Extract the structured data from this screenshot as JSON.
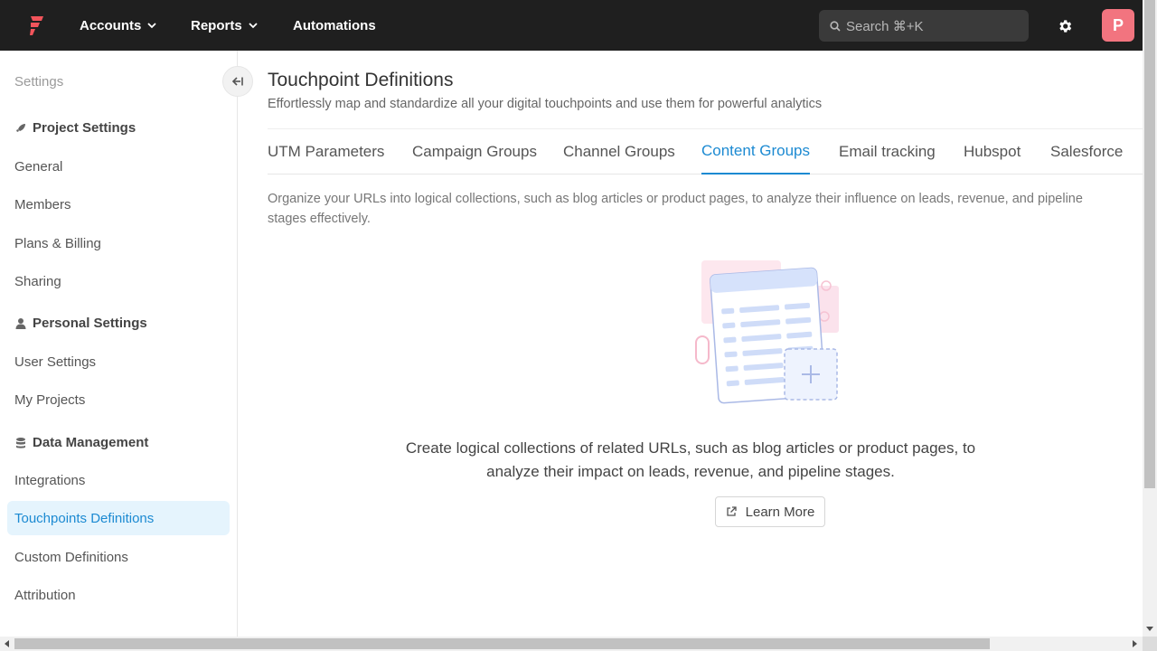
{
  "topbar": {
    "nav": [
      {
        "label": "Accounts",
        "has_dropdown": true
      },
      {
        "label": "Reports",
        "has_dropdown": true
      },
      {
        "label": "Automations",
        "has_dropdown": false
      }
    ],
    "search_placeholder": "Search ⌘+K",
    "avatar_initial": "P",
    "colors": {
      "bar": "#1f1f1f",
      "logo": "#f2545b",
      "avatar": "#f2747f"
    }
  },
  "sidebar": {
    "title": "Settings",
    "sections": [
      {
        "label": "Project Settings",
        "icon": "rocket-icon"
      },
      {
        "label": "Personal Settings",
        "icon": "user-icon"
      },
      {
        "label": "Data Management",
        "icon": "database-icon"
      }
    ],
    "items": [
      {
        "label": "General"
      },
      {
        "label": "Members"
      },
      {
        "label": "Plans & Billing"
      },
      {
        "label": "Sharing"
      },
      {
        "label": "User Settings"
      },
      {
        "label": "My Projects"
      },
      {
        "label": "Integrations"
      },
      {
        "label": "Touchpoints Definitions",
        "active": true
      },
      {
        "label": "Custom Definitions"
      },
      {
        "label": "Attribution"
      }
    ]
  },
  "main": {
    "title": "Touchpoint Definitions",
    "subtitle": "Effortlessly map and standardize all your digital touchpoints and use them for powerful analytics",
    "tabs": [
      {
        "label": "UTM Parameters"
      },
      {
        "label": "Campaign Groups"
      },
      {
        "label": "Channel Groups"
      },
      {
        "label": "Content Groups",
        "active": true
      },
      {
        "label": "Email tracking"
      },
      {
        "label": "Hubspot"
      },
      {
        "label": "Salesforce"
      }
    ],
    "description": "Organize your URLs into logical collections, such as blog articles or product pages, to analyze their influence on leads, revenue, and pipeline stages effectively.",
    "empty_state_line1": "Create logical collections of related URLs, such as blog articles or product pages, to",
    "empty_state_line2": "analyze their impact on leads, revenue, and pipeline stages.",
    "learn_more_label": "Learn More",
    "accent": "#1c8ad2"
  }
}
